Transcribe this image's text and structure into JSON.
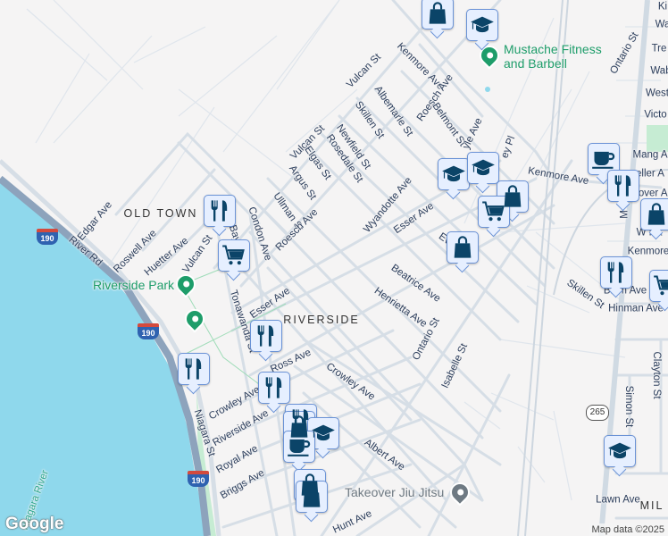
{
  "map": {
    "colors": {
      "water": "#8fd8ec",
      "road": "#d6dee6",
      "highway": "#8da3bc",
      "park": "#c6ecd3",
      "marker_fill": "#e6efff",
      "marker_border": "#6b93d6",
      "icon": "#0b4468",
      "poi_green": "#1e9d6a",
      "poi_gray": "#6f7a83"
    },
    "neighborhoods": [
      "OLD TOWN",
      "RIVERSIDE",
      "MIL"
    ],
    "streets": [
      "Vulcan St",
      "Kenmore Ave",
      "Roesch Ave",
      "Albemarle St",
      "Belmont St",
      "Skillen St",
      "Newfield St",
      "Rosedale St",
      "Vulcan St",
      "Elgas St",
      "Argus St",
      "Ullman St",
      "Roesch Ave",
      "Condon Ave",
      "Wyandotte Ave",
      "Esser Ave",
      "Kenmore Ave",
      "Edgar Ave",
      "Roswell Ave",
      "Huetter Ave",
      "Vulcan St",
      "River Rd",
      "Esser Ave",
      "Tonawanda St",
      "Ross Ave",
      "Crowley Ave",
      "Crowley Ave",
      "Riverside Ave",
      "Royal Ave",
      "Briggs Ave",
      "Niagara St",
      "Albert Ave",
      "Hunt Ave",
      "Beatrice Ave",
      "Henrietta Ave",
      "Ontario St",
      "Isabelle St",
      "Skillen St",
      "Hinman Ave",
      "Blum Ave",
      "Clayton St",
      "Simon St",
      "Lawn Ave",
      "Ontario St",
      "Ki",
      "Wa",
      "Tre",
      "Wab",
      "West",
      "Victo",
      "Mang A",
      "eller A",
      "bover A",
      "Tr",
      "W Ha",
      "Kenmore",
      "Eve",
      "Niagara River",
      "Bay",
      "yle Ave",
      "ey Pl",
      "M"
    ],
    "places": {
      "fitness": "Mustache Fitness and Barbell",
      "park": "Riverside Park",
      "jiujitsu": "Takeover Jiu Jitsu"
    },
    "shields": {
      "interstate": "190",
      "state": "265"
    },
    "markers": [
      "shopping-bag",
      "school",
      "coffee",
      "restaurant",
      "shopping-bag",
      "restaurant",
      "cart",
      "school",
      "school",
      "shopping-bag",
      "cart",
      "shopping-bag",
      "restaurant",
      "cart",
      "restaurant",
      "restaurant",
      "restaurant",
      "restaurant",
      "shopping-bag",
      "school",
      "coffee",
      "shopping-bag",
      "shopping-bag",
      "school"
    ],
    "logo": "Google",
    "attribution": "Map data ©2025"
  }
}
